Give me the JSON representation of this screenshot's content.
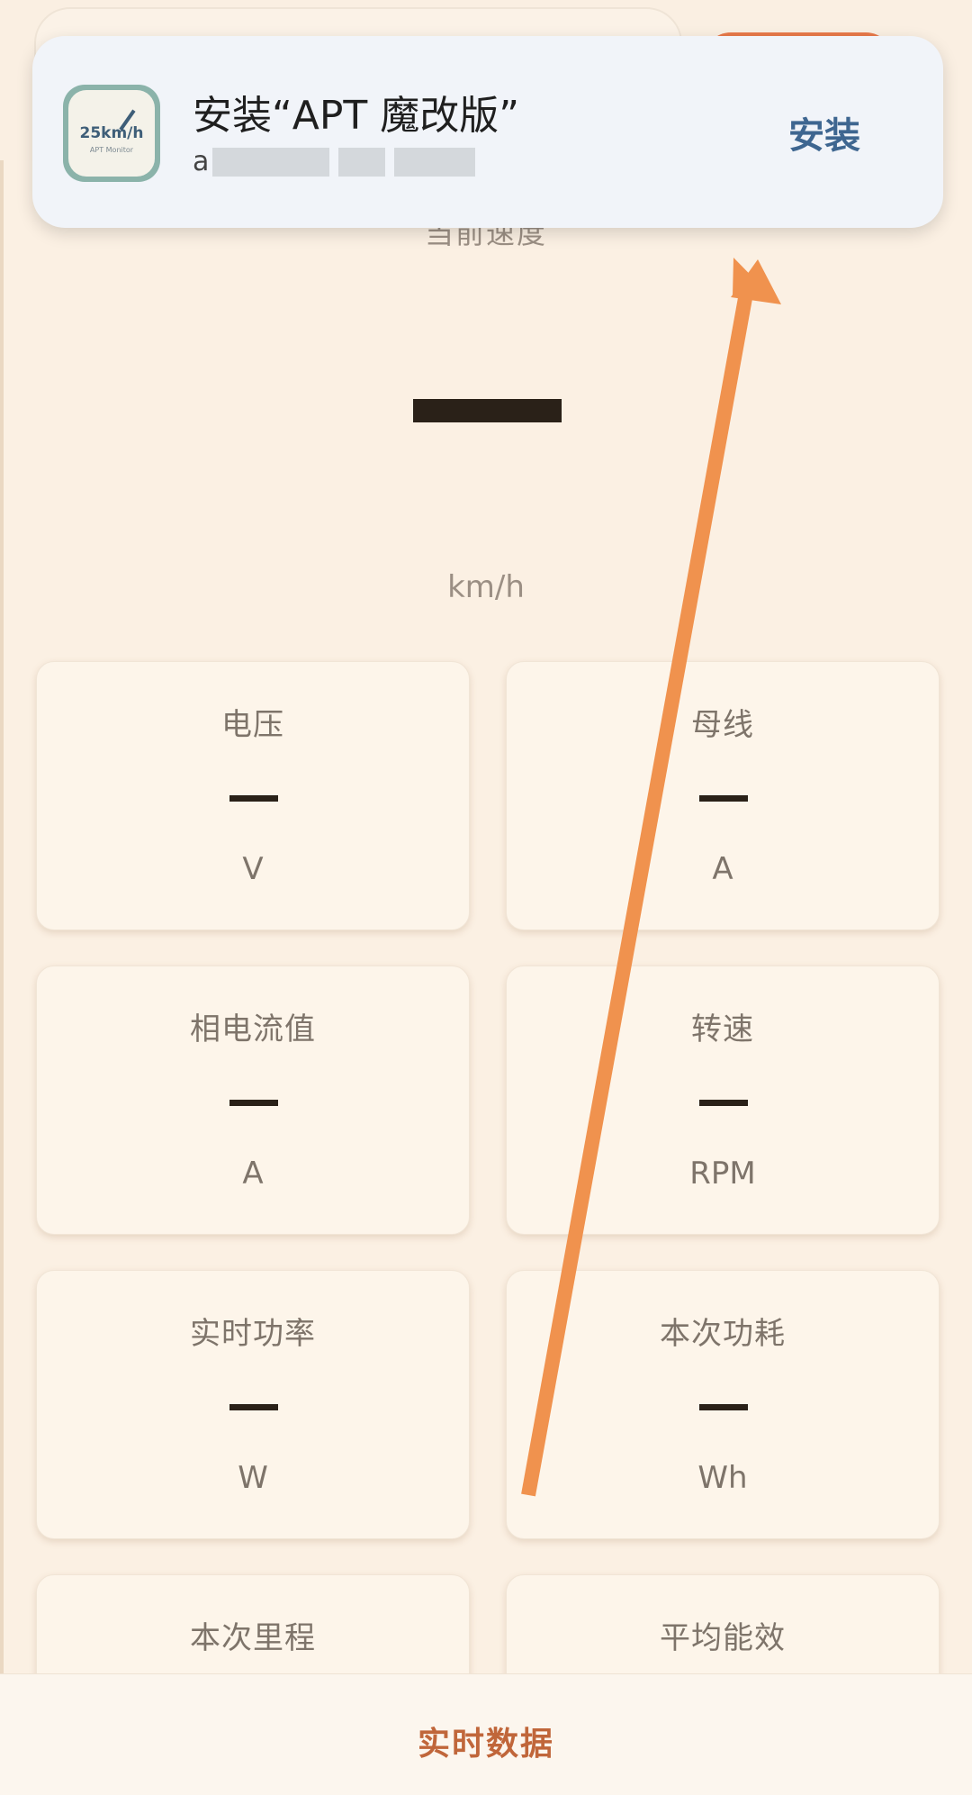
{
  "notification": {
    "title": "安装“APT 魔改版”",
    "subtitle_visible": "a",
    "action": "安装",
    "icon": {
      "name": "app-icon-25kmh",
      "text": "25km/h",
      "subtext": "APT Monitor"
    }
  },
  "speed": {
    "label": "当前速度",
    "value": "—",
    "unit": "km/h"
  },
  "metrics": [
    {
      "title": "电压",
      "value": "—",
      "unit": "V"
    },
    {
      "title": "母线",
      "value": "—",
      "unit": "A"
    },
    {
      "title": "相电流值",
      "value": "—",
      "unit": "A"
    },
    {
      "title": "转速",
      "value": "—",
      "unit": "RPM"
    },
    {
      "title": "实时功率",
      "value": "—",
      "unit": "W"
    },
    {
      "title": "本次功耗",
      "value": "—",
      "unit": "Wh"
    },
    {
      "title": "本次里程",
      "value": "",
      "unit": ""
    },
    {
      "title": "平均能效",
      "value": "",
      "unit": ""
    }
  ],
  "bottom_nav": {
    "active_tab": "实时数据"
  },
  "colors": {
    "background": "#fbf0e3",
    "accent": "#c0663a",
    "arrow": "#f0924e",
    "notification_action": "#3e6690"
  }
}
